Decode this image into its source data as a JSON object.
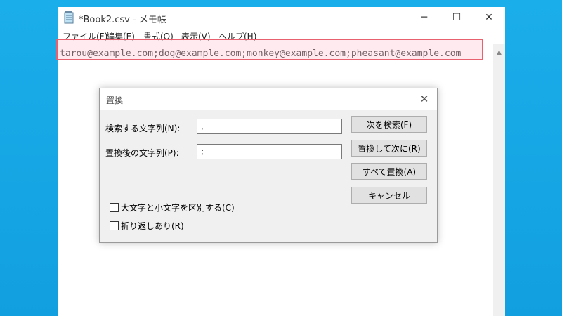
{
  "window": {
    "title": "*Book2.csv - メモ帳",
    "minimize_glyph": "─",
    "maximize_glyph": "☐",
    "close_glyph": "✕"
  },
  "menu": {
    "file": "ファイル(F)",
    "edit": "編集(E)",
    "format": "書式(O)",
    "view": "表示(V)",
    "help": "ヘルプ(H)"
  },
  "editor": {
    "text": "tarou@example.com;dog@example.com;monkey@example.com;pheasant@example.com"
  },
  "dialog": {
    "title": "置換",
    "close_glyph": "✕",
    "find_label": "検索する文字列(N):",
    "find_value": ",",
    "replace_label": "置換後の文字列(P):",
    "replace_value": ";",
    "find_next_button": "次を検索(F)",
    "replace_button": "置換して次に(R)",
    "replace_all_button": "すべて置換(A)",
    "cancel_button": "キャンセル",
    "match_case_label": "大文字と小文字を区別する(C)",
    "wrap_around_label": "折り返しあり(R)"
  },
  "colors": {
    "desktop": "#14a8e8",
    "highlight_border": "#e8616f"
  },
  "icons": {
    "app": "notepad-icon",
    "scroll_up": "scroll-up-arrow-icon"
  }
}
